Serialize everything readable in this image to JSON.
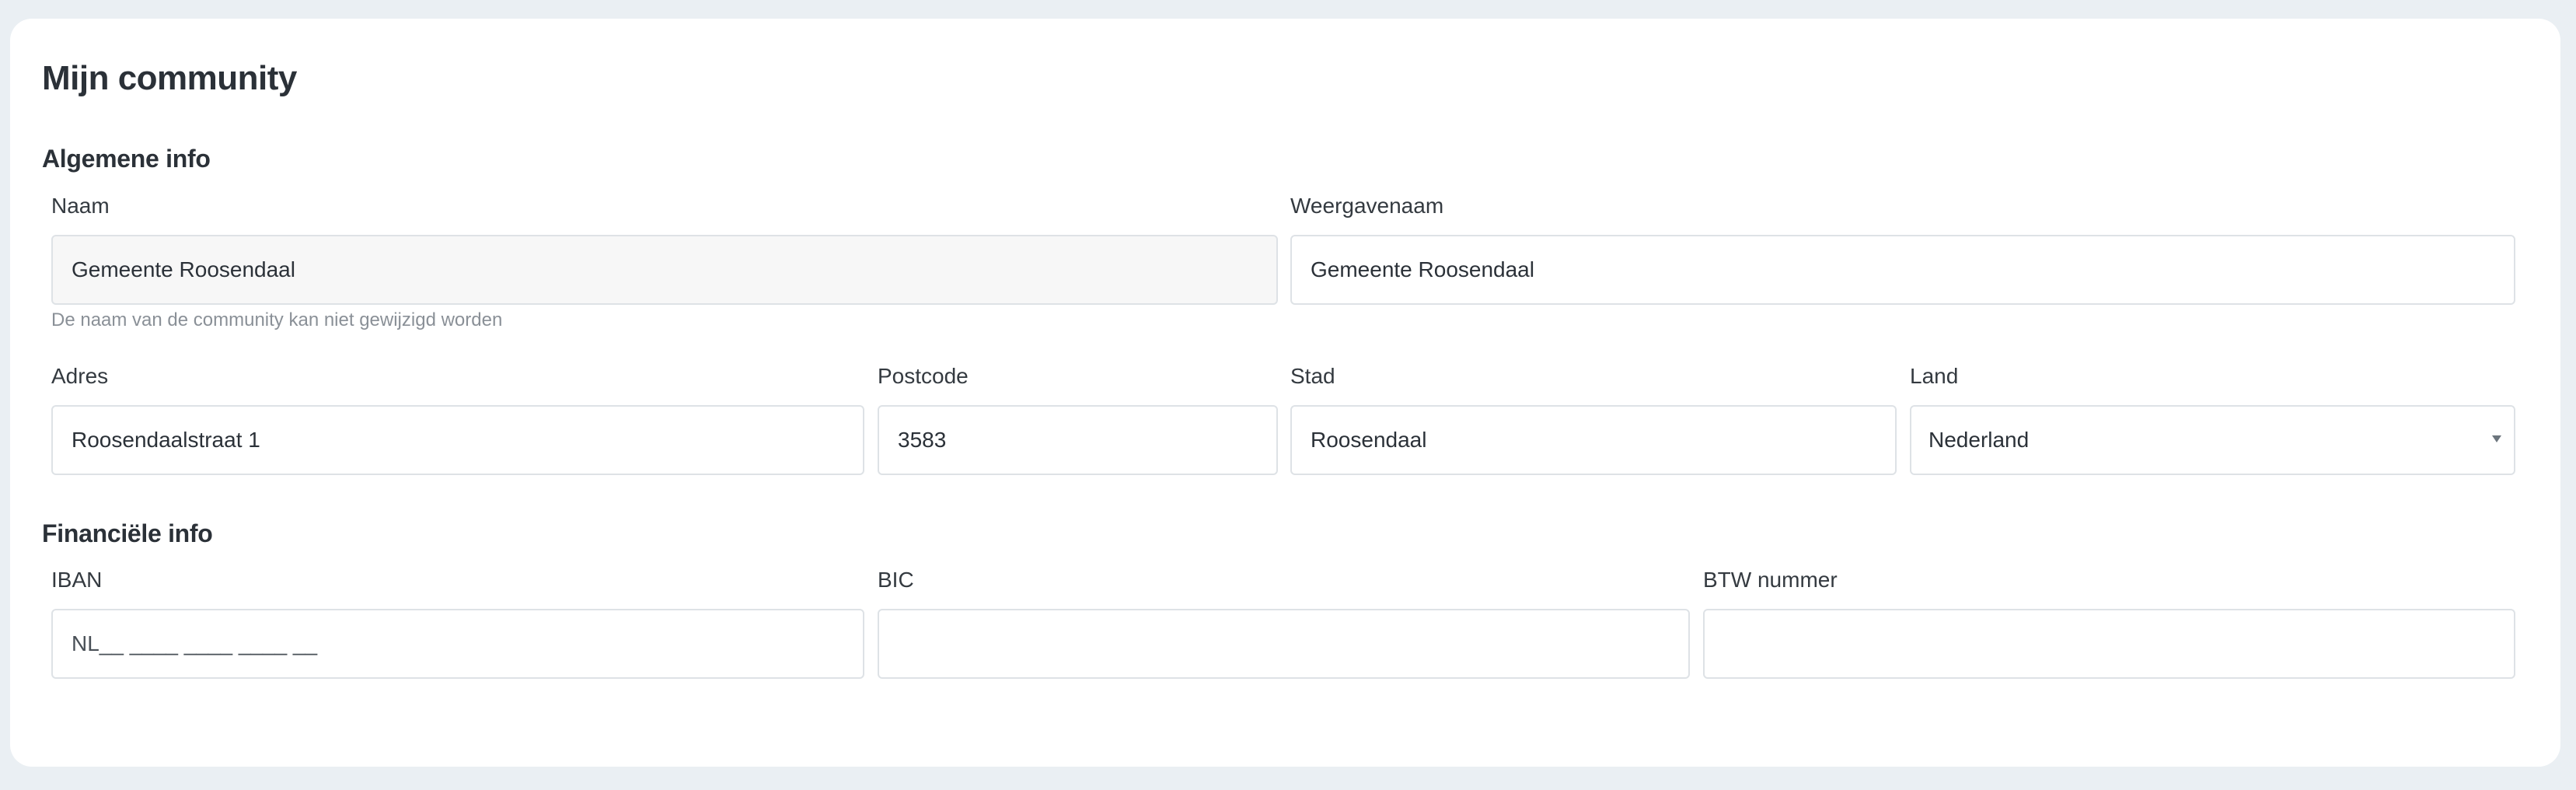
{
  "page": {
    "title": "Mijn community"
  },
  "general": {
    "section_title": "Algemene info",
    "name": {
      "label": "Naam",
      "value": "Gemeente Roosendaal",
      "help": "De naam van de community kan niet gewijzigd worden"
    },
    "display_name": {
      "label": "Weergavenaam",
      "value": "Gemeente Roosendaal"
    },
    "address": {
      "label": "Adres",
      "value": "Roosendaalstraat 1"
    },
    "postcode": {
      "label": "Postcode",
      "value": "3583"
    },
    "city": {
      "label": "Stad",
      "value": "Roosendaal"
    },
    "country": {
      "label": "Land",
      "value": "Nederland"
    }
  },
  "financial": {
    "section_title": "Financiële info",
    "iban": {
      "label": "IBAN",
      "placeholder": "NL__ ____ ____ ____ __"
    },
    "bic": {
      "label": "BIC",
      "placeholder": ""
    },
    "vat": {
      "label": "BTW nummer",
      "placeholder": ""
    }
  },
  "icons": {
    "country_select": "caret-down-icon"
  },
  "colors": {
    "page_background": "#eaeff3",
    "card_background": "#ffffff",
    "readonly_background": "#f7f7f7",
    "border": "#dee2e6",
    "help_text": "#8a9097"
  }
}
